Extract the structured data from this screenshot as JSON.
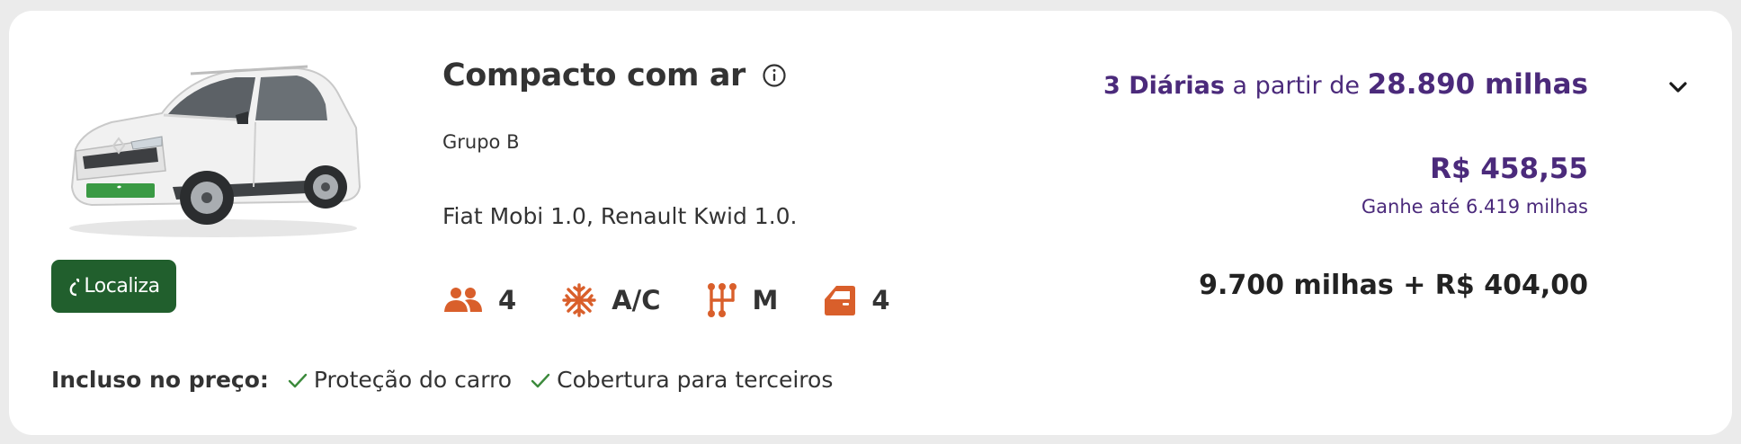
{
  "card": {
    "car_image_alt": "Renault Kwid branco",
    "brand": {
      "name": "Localiza",
      "color": "#215f2d"
    },
    "title": "Compacto com ar",
    "group": "Grupo B",
    "models": "Fiat Mobi 1.0, Renault Kwid 1.0.",
    "features": {
      "passengers": {
        "icon": "people-icon",
        "value": "4"
      },
      "ac": {
        "icon": "snowflake-icon",
        "value": "A/C"
      },
      "transmission": {
        "icon": "gearshift-icon",
        "value": "M"
      },
      "doors": {
        "icon": "car-door-icon",
        "value": "4"
      }
    },
    "included": {
      "label": "Incluso no preço:",
      "items": [
        "Proteção do carro",
        "Cobertura para terceiros"
      ]
    },
    "pricing": {
      "days": "3 Diárias",
      "from_text": "a partir de",
      "miles": "28.890 milhas",
      "price": "R$ 458,55",
      "earn": "Ganhe até 6.419 milhas",
      "mixed": "9.700 milhas + R$ 404,00"
    }
  },
  "colors": {
    "accent_purple": "#4b2a7b",
    "icon_orange": "#d95f2b",
    "check_green": "#3c8a3c",
    "text_dark": "#333333",
    "background": "#ebebeb"
  }
}
